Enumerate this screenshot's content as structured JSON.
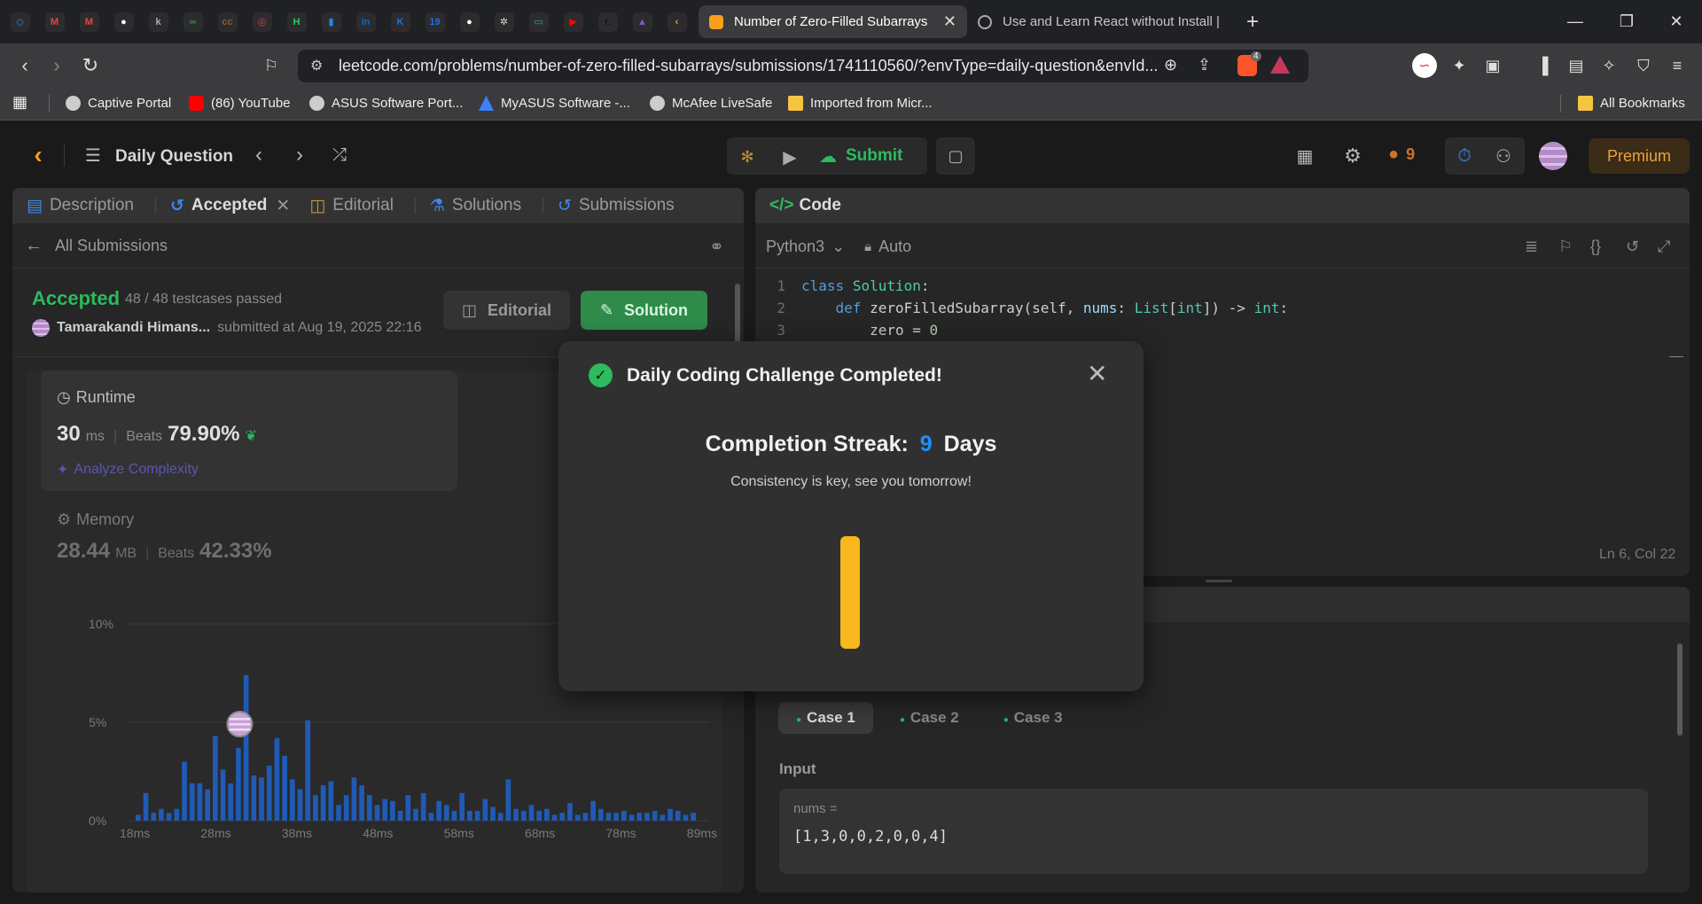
{
  "browser": {
    "pinned_tabs": [
      {
        "name": "devin-icon",
        "glyph": "◇",
        "color": "#3b82f6"
      },
      {
        "name": "gmail-icon",
        "glyph": "M",
        "color": "#ea4335"
      },
      {
        "name": "gmail-icon-2",
        "glyph": "M",
        "color": "#ea4335"
      },
      {
        "name": "github-icon",
        "glyph": "●",
        "color": "#ffffff"
      },
      {
        "name": "k-icon",
        "glyph": "k",
        "color": "#aaaaaa"
      },
      {
        "name": "geeksforgeeks-icon",
        "glyph": "∞",
        "color": "#2f8d46"
      },
      {
        "name": "codechef-icon",
        "glyph": "cc",
        "color": "#8b5a2b"
      },
      {
        "name": "target-icon",
        "glyph": "◎",
        "color": "#e53935"
      },
      {
        "name": "hackerrank-icon",
        "glyph": "H",
        "color": "#2ec866"
      },
      {
        "name": "chart-icon",
        "glyph": "▮",
        "color": "#1e88e5"
      },
      {
        "name": "linkedin-icon",
        "glyph": "in",
        "color": "#0a66c2"
      },
      {
        "name": "k-blue-icon",
        "glyph": "K",
        "color": "#1976d2"
      },
      {
        "name": "calendar-icon",
        "glyph": "19",
        "color": "#1a73e8"
      },
      {
        "name": "github-icon-2",
        "glyph": "●",
        "color": "#ffffff"
      },
      {
        "name": "chatgpt-icon",
        "glyph": "✲",
        "color": "#dddddd"
      },
      {
        "name": "monitor-icon",
        "glyph": "▭",
        "color": "#26a69a"
      },
      {
        "name": "youtube-icon",
        "glyph": "▶",
        "color": "#ff0000"
      },
      {
        "name": "r-icon",
        "glyph": "r.",
        "color": "#111111"
      },
      {
        "name": "rocket-icon",
        "glyph": "▲",
        "color": "#7e57c2"
      },
      {
        "name": "leetcode-icon",
        "glyph": "‹",
        "color": "#f89f1b"
      }
    ],
    "tabs": [
      {
        "title": "Number of Zero-Filled Subarrays",
        "active": true
      },
      {
        "title": "Use and Learn React without Install |",
        "active": false
      }
    ],
    "url": "leetcode.com/problems/number-of-zero-filled-subarrays/submissions/1741110560/?envType=daily-question&envId...",
    "brave_badge": "4",
    "bookmarks": [
      "Captive Portal",
      "(86) YouTube",
      "ASUS Software Port...",
      "MyASUS Software -...",
      "McAfee LiveSafe",
      "Imported from Micr..."
    ],
    "all_bookmarks": "All Bookmarks"
  },
  "lc_header": {
    "daily_question": "Daily Question",
    "submit": "Submit",
    "streak_count": "9",
    "premium": "Premium"
  },
  "left_panel": {
    "tabs": [
      "Description",
      "Accepted",
      "Editorial",
      "Solutions",
      "Submissions"
    ],
    "all_submissions": "All Submissions",
    "status": "Accepted",
    "testcases": "48 / 48 testcases passed",
    "user": "Tamarakandi Himans...",
    "submitted_at": "submitted at Aug 19, 2025 22:16",
    "editorial_btn": "Editorial",
    "solution_btn": "Solution",
    "runtime_label": "Runtime",
    "runtime_value": "30",
    "runtime_unit": "ms",
    "beats_label": "Beats",
    "runtime_beats": "79.90%",
    "analyze": "Analyze Complexity",
    "memory_label": "Memory",
    "memory_value": "28.44",
    "memory_unit": "MB",
    "memory_beats": "42.33%"
  },
  "chart_data": {
    "type": "bar",
    "y_ticks": [
      "10%",
      "5%",
      "0%"
    ],
    "x_ticks": [
      "18ms",
      "28ms",
      "38ms",
      "48ms",
      "58ms",
      "68ms",
      "78ms",
      "89ms"
    ],
    "ylim": [
      0,
      10
    ],
    "values": [
      0.3,
      1.4,
      0.4,
      0.6,
      0.4,
      0.6,
      3.0,
      1.9,
      1.9,
      1.6,
      4.3,
      2.6,
      1.9,
      3.7,
      7.4,
      2.3,
      2.2,
      2.8,
      4.2,
      3.3,
      2.1,
      1.6,
      5.1,
      1.3,
      1.8,
      2.0,
      0.8,
      1.3,
      2.2,
      1.8,
      1.3,
      0.8,
      1.1,
      1.0,
      0.5,
      1.3,
      0.6,
      1.4,
      0.4,
      1.0,
      0.8,
      0.5,
      1.4,
      0.5,
      0.5,
      1.1,
      0.7,
      0.4,
      2.1,
      0.6,
      0.5,
      0.8,
      0.5,
      0.6,
      0.3,
      0.4,
      0.9,
      0.3,
      0.4,
      1.0,
      0.6,
      0.4,
      0.4,
      0.5,
      0.3,
      0.4,
      0.4,
      0.5,
      0.3,
      0.6,
      0.5,
      0.3,
      0.4
    ],
    "highlight_index": 14,
    "bar_color": "#1f5ab5"
  },
  "code_panel": {
    "title": "Code",
    "language": "Python3",
    "auto": "Auto",
    "lines": [
      {
        "n": "1",
        "text": "class Solution:"
      },
      {
        "n": "2",
        "text": "    def zeroFilledSubarray(self, nums: List[int]) -> int:"
      },
      {
        "n": "3",
        "text": "        zero = 0"
      }
    ],
    "cursor": "Ln 6, Col 22"
  },
  "testcase_panel": {
    "cases": [
      "Case 1",
      "Case 2",
      "Case 3"
    ],
    "input_label": "Input",
    "var_label": "nums =",
    "var_value": "[1,3,0,0,2,0,0,4]"
  },
  "modal": {
    "title": "Daily Coding Challenge Completed!",
    "streak_prefix": "Completion Streak:",
    "streak_value": "9",
    "streak_suffix": "Days",
    "message": "Consistency is key, see you tomorrow!",
    "accent": "#1a90ff",
    "bar_color": "#f8b81e"
  }
}
